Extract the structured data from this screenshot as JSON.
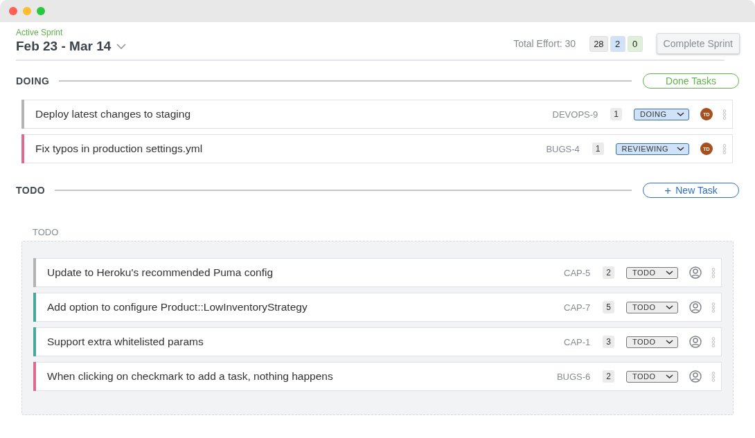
{
  "header": {
    "label": "Active Sprint",
    "title": "Feb 23 - Mar 14",
    "total_effort": "Total Effort: 30",
    "counters": [
      {
        "value": "28",
        "color": "#ebebeb"
      },
      {
        "value": "2",
        "color": "#cfe2f7"
      },
      {
        "value": "0",
        "color": "#dff0d8"
      }
    ],
    "button": "Complete Sprint"
  },
  "sections": [
    {
      "title": "DOING",
      "action": {
        "kind": "done",
        "label": "Done Tasks"
      },
      "tasks": [
        {
          "title": "Deploy latest changes to staging",
          "key": "DEVOPS-9",
          "points": "1",
          "status": {
            "label": "DOING",
            "kind": "active"
          },
          "assignee": "TD",
          "color": "#b4b4b4"
        },
        {
          "title": "Fix typos in production settings.yml",
          "key": "BUGS-4",
          "points": "1",
          "status": {
            "label": "REVIEWING",
            "kind": "active"
          },
          "assignee": "TD",
          "color": "#de6a8f"
        }
      ]
    },
    {
      "title": "TODO",
      "action": {
        "kind": "new",
        "icon": "+",
        "label": "New Task"
      },
      "group_label": "TODO",
      "tasks": [
        {
          "title": "Update to Heroku's recommended Puma config",
          "key": "CAP-5",
          "points": "2",
          "status": {
            "label": "TODO",
            "kind": "idle"
          },
          "color": "#b4b4b4"
        },
        {
          "title": "Add option to configure Product::LowInventoryStrategy",
          "key": "CAP-7",
          "points": "5",
          "status": {
            "label": "TODO",
            "kind": "idle"
          },
          "color": "#48a89b"
        },
        {
          "title": "Support extra whitelisted params",
          "key": "CAP-1",
          "points": "3",
          "status": {
            "label": "TODO",
            "kind": "idle"
          },
          "color": "#48a89b"
        },
        {
          "title": "When clicking on checkmark to add a task, nothing happens",
          "key": "BUGS-6",
          "points": "2",
          "status": {
            "label": "TODO",
            "kind": "idle"
          },
          "color": "#de6a8f"
        }
      ]
    }
  ]
}
